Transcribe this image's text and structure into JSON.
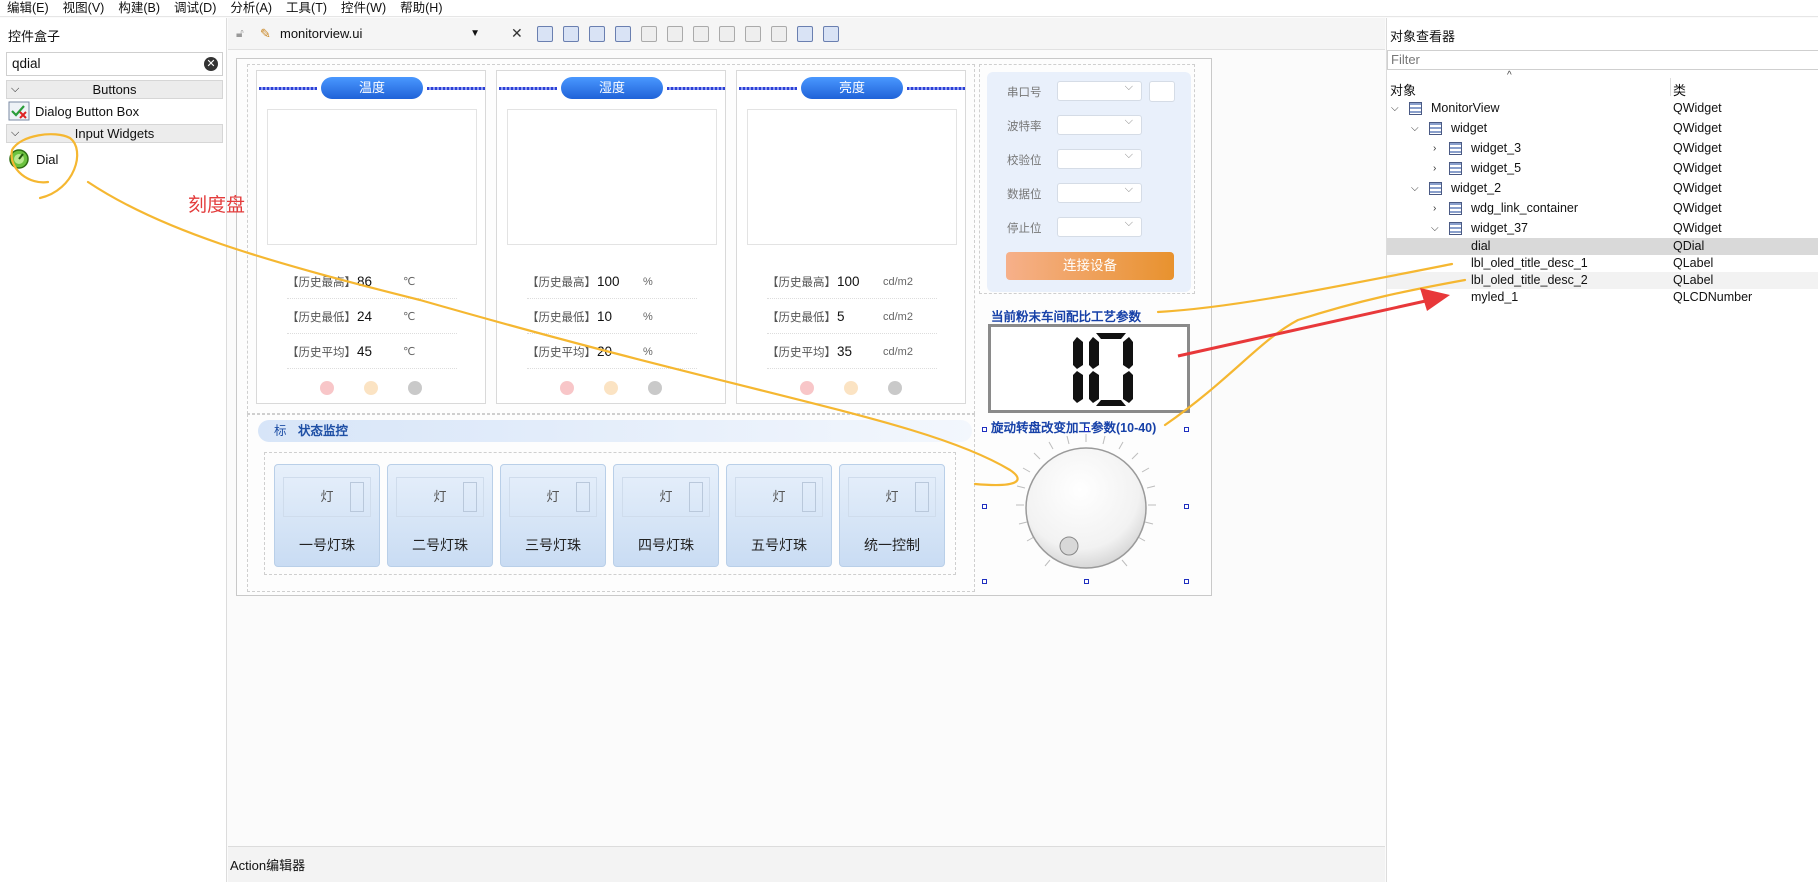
{
  "menu": [
    "编辑(E)",
    "视图(V)",
    "构建(B)",
    "调试(D)",
    "分析(A)",
    "工具(T)",
    "控件(W)",
    "帮助(H)"
  ],
  "widget_box": {
    "title": "控件盒子",
    "search": "qdial",
    "cat_buttons": "Buttons",
    "item_dialog": "Dialog Button Box",
    "cat_input": "Input Widgets",
    "item_dial": "Dial"
  },
  "toolbar": {
    "file": "monitorview.ui",
    "close": "✕"
  },
  "sensors": [
    {
      "title": "温度",
      "rows": [
        {
          "label": "【历史最高】",
          "value": "86",
          "unit": "℃"
        },
        {
          "label": "【历史最低】",
          "value": "24",
          "unit": "℃"
        },
        {
          "label": "【历史平均】",
          "value": "45",
          "unit": "℃"
        }
      ]
    },
    {
      "title": "湿度",
      "rows": [
        {
          "label": "【历史最高】",
          "value": "100",
          "unit": "%"
        },
        {
          "label": "【历史最低】",
          "value": "10",
          "unit": "%"
        },
        {
          "label": "【历史平均】",
          "value": "20",
          "unit": "%"
        }
      ]
    },
    {
      "title": "亮度",
      "rows": [
        {
          "label": "【历史最高】",
          "value": "100",
          "unit": "cd/m2"
        },
        {
          "label": "【历史最低】",
          "value": "5",
          "unit": "cd/m2"
        },
        {
          "label": "【历史平均】",
          "value": "35",
          "unit": "cd/m2"
        }
      ]
    }
  ],
  "status": {
    "icon": "标",
    "title": "状态监控"
  },
  "lamps": {
    "lamp_label": "灯",
    "names": [
      "一号灯珠",
      "二号灯珠",
      "三号灯珠",
      "四号灯珠",
      "五号灯珠",
      "统一控制"
    ]
  },
  "serial": {
    "labels": [
      "串口号",
      "波特率",
      "校验位",
      "数据位",
      "停止位"
    ],
    "connect": "连接设备"
  },
  "oled": {
    "title1": "当前粉末车间配比工艺参数",
    "lcd_value": "10",
    "title2": "旋动转盘改变加工参数(10-40)"
  },
  "annotation": {
    "text": "刻度盘"
  },
  "inspector": {
    "title": "对象查看器",
    "filter": "Filter",
    "col_object": "对象",
    "col_class": "类",
    "rows": [
      {
        "name": "MonitorView",
        "cls": "QWidget"
      },
      {
        "name": "widget",
        "cls": "QWidget"
      },
      {
        "name": "widget_3",
        "cls": "QWidget"
      },
      {
        "name": "widget_5",
        "cls": "QWidget"
      },
      {
        "name": "widget_2",
        "cls": "QWidget"
      },
      {
        "name": "wdg_link_container",
        "cls": "QWidget"
      },
      {
        "name": "widget_37",
        "cls": "QWidget"
      },
      {
        "name": "dial",
        "cls": "QDial"
      },
      {
        "name": "lbl_oled_title_desc_1",
        "cls": "QLabel"
      },
      {
        "name": "lbl_oled_title_desc_2",
        "cls": "QLabel"
      },
      {
        "name": "myled_1",
        "cls": "QLCDNumber"
      }
    ]
  },
  "bottom": {
    "action_editor": "Action编辑器"
  },
  "colors": {
    "accent": "#1f62d8",
    "annotation": "#f5b731",
    "arrow": "#e8383a"
  }
}
